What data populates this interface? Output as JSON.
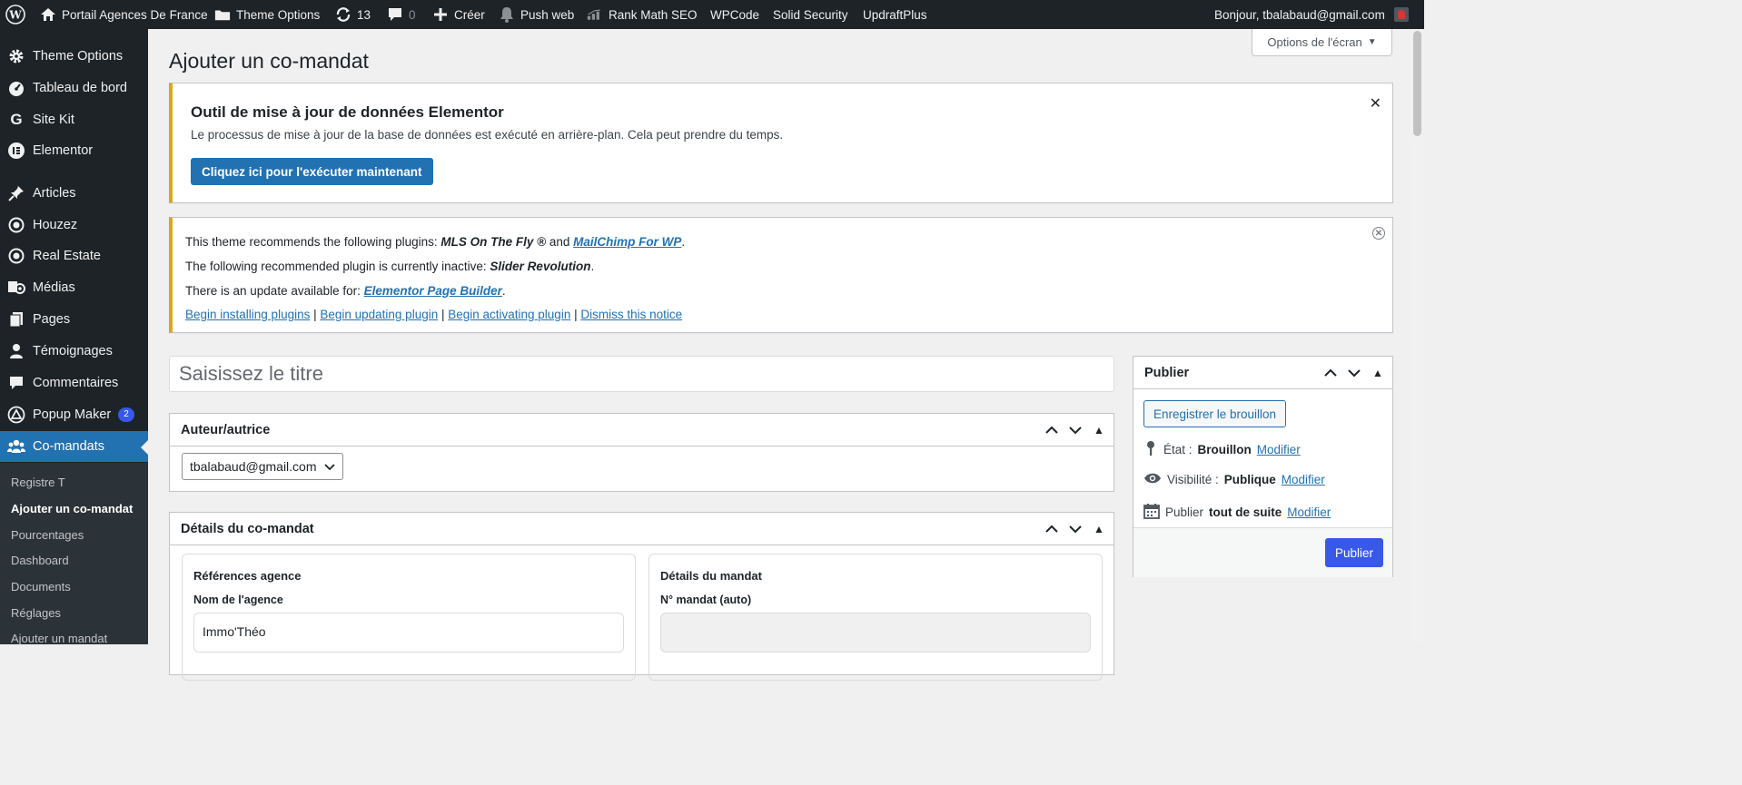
{
  "adminbar": {
    "site_name": "Portail Agences De France",
    "theme_options": "Theme Options",
    "updates_count": "13",
    "comments_count": "0",
    "create": "Créer",
    "push_web": "Push web",
    "rank_math": "Rank Math SEO",
    "wpcode": "WPCode",
    "solid_security": "Solid Security",
    "updraftplus": "UpdraftPlus",
    "greeting": "Bonjour, tbalabaud@gmail.com"
  },
  "sidebar": {
    "items": [
      {
        "label": "Theme Options",
        "icon": "gear-icon"
      },
      {
        "label": "Tableau de bord",
        "icon": "dashboard-icon"
      },
      {
        "label": "Site Kit",
        "icon": "google-icon"
      },
      {
        "label": "Elementor",
        "icon": "elementor-icon"
      },
      {
        "label": "Articles",
        "icon": "pin-icon"
      },
      {
        "label": "Houzez",
        "icon": "circle-icon"
      },
      {
        "label": "Real Estate",
        "icon": "circle-icon"
      },
      {
        "label": "Médias",
        "icon": "media-icon"
      },
      {
        "label": "Pages",
        "icon": "pages-icon"
      },
      {
        "label": "Témoignages",
        "icon": "user-icon"
      },
      {
        "label": "Commentaires",
        "icon": "comment-icon"
      },
      {
        "label": "Popup Maker",
        "icon": "popup-icon",
        "badge": "2"
      },
      {
        "label": "Co-mandats",
        "icon": "group-icon"
      }
    ],
    "submenu": [
      "Registre T",
      "Ajouter un co-mandat",
      "Pourcentages",
      "Dashboard",
      "Documents",
      "Réglages",
      "Ajouter un mandat"
    ]
  },
  "screen_options": "Options de l'écran",
  "page_title": "Ajouter un co-mandat",
  "elementor_notice": {
    "title": "Outil de mise à jour de données Elementor",
    "text": "Le processus de mise à jour de la base de données est exécuté en arrière-plan. Cela peut prendre du temps.",
    "button": "Cliquez ici pour l'exécuter maintenant"
  },
  "tgm_notice": {
    "line1_prefix": "This theme recommends the following plugins: ",
    "line1_plugin1": "MLS On The Fly ®",
    "line1_and": " and ",
    "line1_plugin2": "MailChimp For WP",
    "line1_suffix": ".",
    "line2_prefix": "The following recommended plugin is currently inactive: ",
    "line2_plugin": "Slider Revolution",
    "line2_suffix": ".",
    "line3_prefix": "There is an update available for: ",
    "line3_plugin": "Elementor Page Builder",
    "line3_suffix": ".",
    "links": [
      "Begin installing plugins",
      "Begin updating plugin",
      "Begin activating plugin",
      "Dismiss this notice"
    ],
    "separator": " | "
  },
  "title_placeholder": "Saisissez le titre",
  "author_box": {
    "heading": "Auteur/autrice",
    "selected": "tbalabaud@gmail.com"
  },
  "details_box": {
    "heading": "Détails du co-mandat",
    "left_title": "Références agence",
    "left_label": "Nom de l'agence",
    "left_value": "Immo'Théo",
    "right_title": "Détails du mandat",
    "right_label": "N° mandat (auto)",
    "right_value": ""
  },
  "publish_box": {
    "heading": "Publier",
    "draft_button": "Enregistrer le brouillon",
    "status_label": "État : ",
    "status_value": "Brouillon",
    "visibility_label": "Visibilité : ",
    "visibility_value": "Publique",
    "publish_label": "Publier ",
    "publish_value": "tout de suite",
    "modify": "Modifier",
    "publish_button": "Publier"
  },
  "colors": {
    "adminbar": "#1d2327",
    "accent": "#2271b1",
    "publish": "#3858e9",
    "notice_warning": "#dba617"
  }
}
